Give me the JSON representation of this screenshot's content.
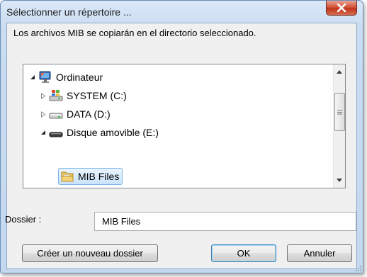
{
  "dialog": {
    "title": "Sélectionner un répertoire ...",
    "message": "Los archivos MIB se copiarán en el directorio seleccionado."
  },
  "tree": {
    "items": [
      {
        "label": "Ordinateur",
        "icon": "computer-icon",
        "expanded": true
      },
      {
        "label": "SYSTEM (C:)",
        "icon": "system-drive-icon",
        "expanded": false
      },
      {
        "label": "DATA (D:)",
        "icon": "drive-icon",
        "expanded": false
      },
      {
        "label": "Disque amovible (E:)",
        "icon": "removable-drive-icon",
        "expanded": true
      },
      {
        "label": "MIB Files",
        "icon": "folder-icon",
        "selected": true
      }
    ]
  },
  "folder": {
    "label": "Dossier :",
    "value": "MIB Files"
  },
  "buttons": {
    "new_folder": "Créer un nouveau dossier",
    "ok": "OK",
    "cancel": "Annuler"
  },
  "colors": {
    "close_button": "#c9462c",
    "selection_border": "#7db3e8",
    "window_frame": "#c4d8ef"
  }
}
